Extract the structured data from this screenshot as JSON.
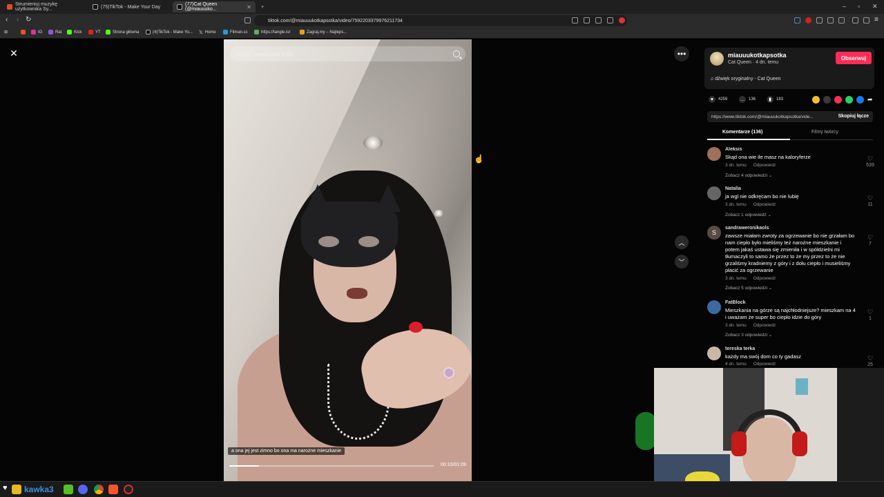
{
  "browser": {
    "tabs": [
      {
        "label": "Strumieniuj muzykę użytkownika Sy..."
      },
      {
        "label": "(75)TikTok - Make Your Day"
      },
      {
        "label": "(77)Cat Queen (@miauuuko..."
      }
    ],
    "new_tab": "+",
    "url": "tiktok.com/@miauuukotkapsotka/video/7592203379976211734",
    "bookmarks": [
      "IG",
      "Rat",
      "Kick",
      "YT",
      "Strona główna",
      "(4)TikTok - Make Yo...",
      "Home",
      "Filman.cc",
      "https://tangle.io/",
      "Zagraj.my – Najleps..."
    ]
  },
  "video": {
    "search_placeholder": "Znajdź powiązane treści",
    "caption": "a ona jej jest zimno bo ona ma narożne mieszkanie",
    "timecode": "00:10/01:09",
    "progress": 0.145
  },
  "author": {
    "username": "miauuukotkapsotka",
    "subline": "Cat Queen · 4 dn. temu",
    "follow": "Obserwuj",
    "sound": "dźwięk oryginalny - Cat Queen"
  },
  "stats": {
    "likes": "4259",
    "comments": "136",
    "saves": "183"
  },
  "link": {
    "url": "https://www.tiktok.com/@miauuukotkapsotka/vide...",
    "copy": "Skopiuj łącze"
  },
  "panel_tabs": {
    "comments": "Komentarze (136)",
    "creator_videos": "Filmy twórcy"
  },
  "comments": [
    {
      "user": "Aleksis",
      "text": "Skąd ona wie ile masz na kaloryferze",
      "time": "3 dn. temu",
      "reply": "Odpowiedz",
      "replies": "Zobacz 4 odpowiedzi",
      "likes": "539",
      "avatar_color": "#a0705a"
    },
    {
      "user": "Natalia",
      "text": "ja wgl nie odkręcam bo nie lubię",
      "time": "3 dn. temu",
      "reply": "Odpowiedz",
      "replies": "Zobacz 1 odpowiedź",
      "likes": "11",
      "avatar_color": "#666666"
    },
    {
      "user": "sandraweronikaols",
      "text": "zawsze miałam zwroty za ogrzewanie bo nie grzałam bo nam ciepło było mieliśmy też narożne mieszkanie i potem jakaś ustawa się zmieniła i w spółdzielni mi tłumaczyli to samo że przez to że my przez to że nie grzaliśmy kradniemy z góry i z dołu ciepło i musieliśmy płacić za ogrzewanie",
      "time": "3 dn. temu",
      "reply": "Odpowiedz",
      "replies": "Zobacz 5 odpowiedzi",
      "likes": "7",
      "avatar_color": "#5a4a44",
      "avatar_letter": "S"
    },
    {
      "user": "FatBlock",
      "text": "Mieszkania na górze są najchłodniejsze? mieszkam na 4 i uważam że super bo ciepło idzie do góry",
      "time": "3 dn. temu",
      "reply": "Odpowiedz",
      "replies": "Zobacz 3 odpowiedzi",
      "likes": "1",
      "avatar_color": "#3a6aa0"
    },
    {
      "user": "tereska terka",
      "text": "każdy ma swój dom co ty gadasz",
      "time": "4 dn. temu",
      "reply": "Odpowiedz",
      "replies": "",
      "likes": "25",
      "avatar_color": "#c9b8a8"
    }
  ],
  "taskbar": {
    "label": "kawka3"
  },
  "colors": {
    "accent": "#fe2c55",
    "taskbar_label": "#3c8de0"
  },
  "icons": [
    "close-icon",
    "more-icon",
    "search-icon",
    "chevron-up-icon",
    "chevron-down-icon",
    "heart-icon",
    "comment-icon",
    "bookmark-icon",
    "music-note-icon",
    "share-icon"
  ]
}
